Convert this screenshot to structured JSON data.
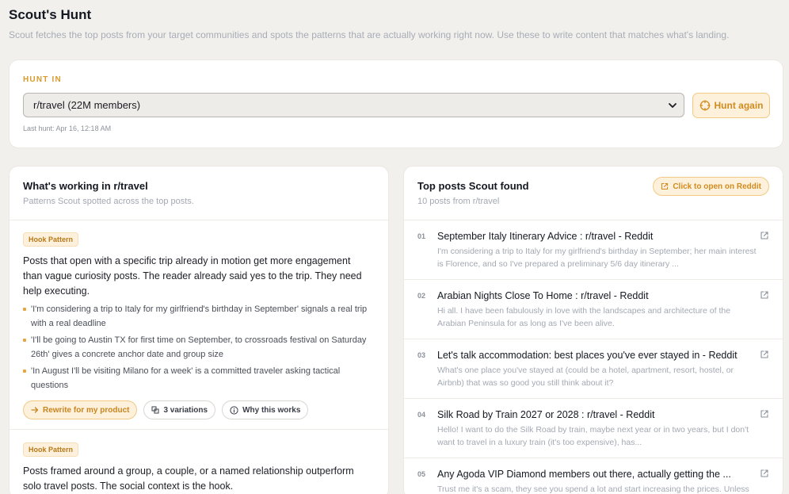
{
  "header": {
    "title": "Scout's Hunt",
    "subtitle": "Scout fetches the top posts from your target communities and spots the patterns that are actually working right now. Use these to write content that matches what's landing."
  },
  "hunt": {
    "label": "HUNT IN",
    "selected": "r/travel (22M members)",
    "button": "Hunt again",
    "last_hunt": "Last hunt: Apr 16, 12:18 AM"
  },
  "working": {
    "title": "What's working in r/travel",
    "subtitle": "Patterns Scout spotted across the top posts.",
    "patterns": [
      {
        "tag": "Hook Pattern",
        "body": "Posts that open with a specific trip already in motion get more engagement than vague curiosity posts. The reader already said yes to the trip. They need help executing.",
        "bullets": [
          "'I'm considering a trip to Italy for my girlfriend's birthday in September' signals a real trip with a real deadline",
          "'I'll be going to Austin TX for first time on September, to crossroads festival on Saturday 26th' gives a concrete anchor date and group size",
          "'In August I'll be visiting Milano for a week' is a committed traveler asking tactical questions"
        ],
        "actions": {
          "rewrite": "Rewrite for my product",
          "variations": "3 variations",
          "why": "Why this works"
        }
      },
      {
        "tag": "Hook Pattern",
        "body": "Posts framed around a group, a couple, or a named relationship outperform solo travel posts. The social context is the hook."
      }
    ]
  },
  "top_posts": {
    "title": "Top posts Scout found",
    "subtitle": "10 posts from r/travel",
    "open_button": "Click to open on Reddit",
    "posts": [
      {
        "num": "01",
        "title": "September Italy Itinerary Advice : r/travel - Reddit",
        "snippet": "I'm considering a trip to Italy for my girlfriend's birthday in September; her main interest is Florence, and so I've prepared a preliminary 5/6 day itinerary ..."
      },
      {
        "num": "02",
        "title": "Arabian Nights Close To Home : r/travel - Reddit",
        "snippet": "Hi all. I have been fabulously in love with the landscapes and architecture of the Arabian Peninsula for as long as I've been alive."
      },
      {
        "num": "03",
        "title": "Let's talk accommodation: best places you've ever stayed in - Reddit",
        "snippet": "What's one place you've stayed at (could be a hotel, apartment, resort, hostel, or Airbnb) that was so good you still think about it?"
      },
      {
        "num": "04",
        "title": "Silk Road by Train 2027 or 2028 : r/travel - Reddit",
        "snippet": "Hello! I want to do the Silk Road by train, maybe next year or in two years, but I don't want to travel in a luxury train (it's too expensive), has..."
      },
      {
        "num": "05",
        "title": "Any Agoda VIP Diamond members out there, actually getting the ...",
        "snippet": "Trust me it's a scam, they see you spend a lot and start increasing the prices. Unless it's"
      }
    ]
  },
  "colors": {
    "accent": "#d89a2c",
    "accent_bg": "#fdf1dc",
    "page_bg": "#f2f0ec"
  }
}
